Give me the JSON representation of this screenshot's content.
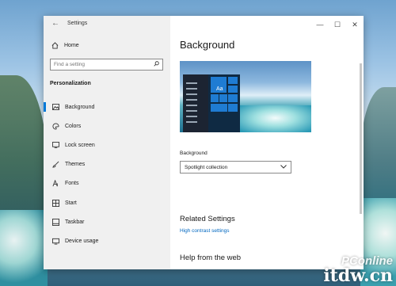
{
  "window": {
    "title": "Settings",
    "controls": {
      "minimize": "—",
      "maximize": "☐",
      "close": "✕"
    }
  },
  "sidebar": {
    "home": "Home",
    "search_placeholder": "Find a setting",
    "section_title": "Personalization",
    "items": [
      {
        "label": "Background",
        "icon": "picture-icon",
        "selected": true
      },
      {
        "label": "Colors",
        "icon": "palette-icon",
        "selected": false
      },
      {
        "label": "Lock screen",
        "icon": "lock-screen-icon",
        "selected": false
      },
      {
        "label": "Themes",
        "icon": "brush-icon",
        "selected": false
      },
      {
        "label": "Fonts",
        "icon": "font-icon",
        "selected": false
      },
      {
        "label": "Start",
        "icon": "start-icon",
        "selected": false
      },
      {
        "label": "Taskbar",
        "icon": "taskbar-icon",
        "selected": false
      },
      {
        "label": "Device usage",
        "icon": "device-icon",
        "selected": false
      }
    ]
  },
  "content": {
    "title": "Background",
    "preview_tile_text": "Aa",
    "background_label": "Background",
    "background_value": "Spotlight collection",
    "related_title": "Related Settings",
    "related_link": "High contrast settings",
    "help_title": "Help from the web"
  },
  "desktop": {
    "watermark_top": "PConline",
    "watermark_bottom": "itdw.cn"
  },
  "colors": {
    "accent": "#0078d7",
    "link": "#0067c0",
    "sidebar_bg": "#f0f0f0"
  }
}
